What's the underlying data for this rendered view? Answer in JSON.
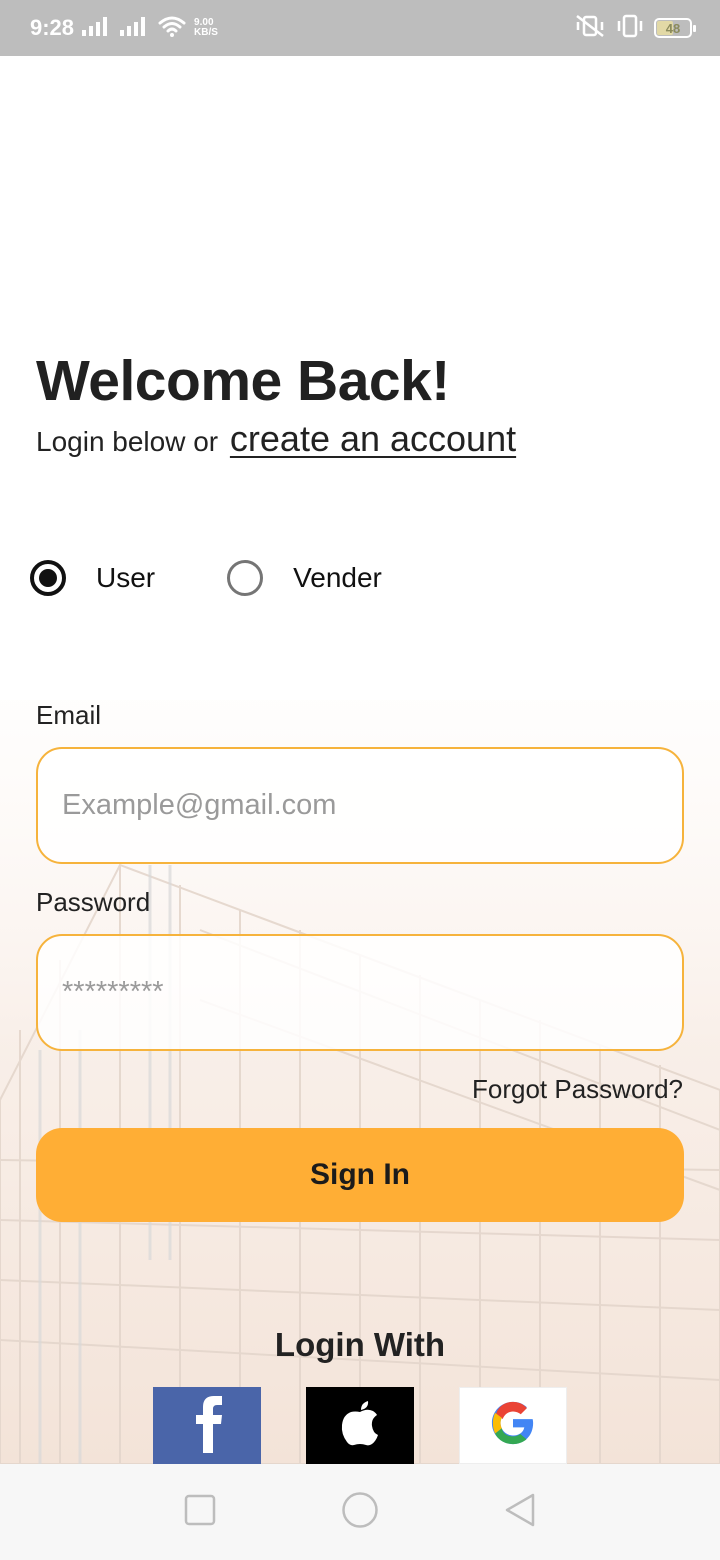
{
  "status_bar": {
    "time": "9:28",
    "net_speed_value": "9.00",
    "net_speed_unit": "KB/S",
    "battery": "48",
    "battery_level": 0.48
  },
  "header": {
    "title": "Welcome Back!",
    "subtitle_prefix": "Login below or",
    "create_account_link": "create an account"
  },
  "account_type": {
    "options": [
      {
        "label": "User",
        "selected": true
      },
      {
        "label": "Vender",
        "selected": false
      }
    ]
  },
  "form": {
    "email_label": "Email",
    "email_placeholder": "Example@gmail.com",
    "password_label": "Password",
    "password_placeholder": "*********",
    "forgot_password": "Forgot Password?",
    "sign_in_label": "Sign In"
  },
  "social_login": {
    "title": "Login With",
    "providers": [
      "facebook",
      "apple",
      "google"
    ]
  },
  "colors": {
    "accent": "#ffae35",
    "field_border": "#f6b33c",
    "facebook": "#4a65a9",
    "apple": "#000000"
  }
}
